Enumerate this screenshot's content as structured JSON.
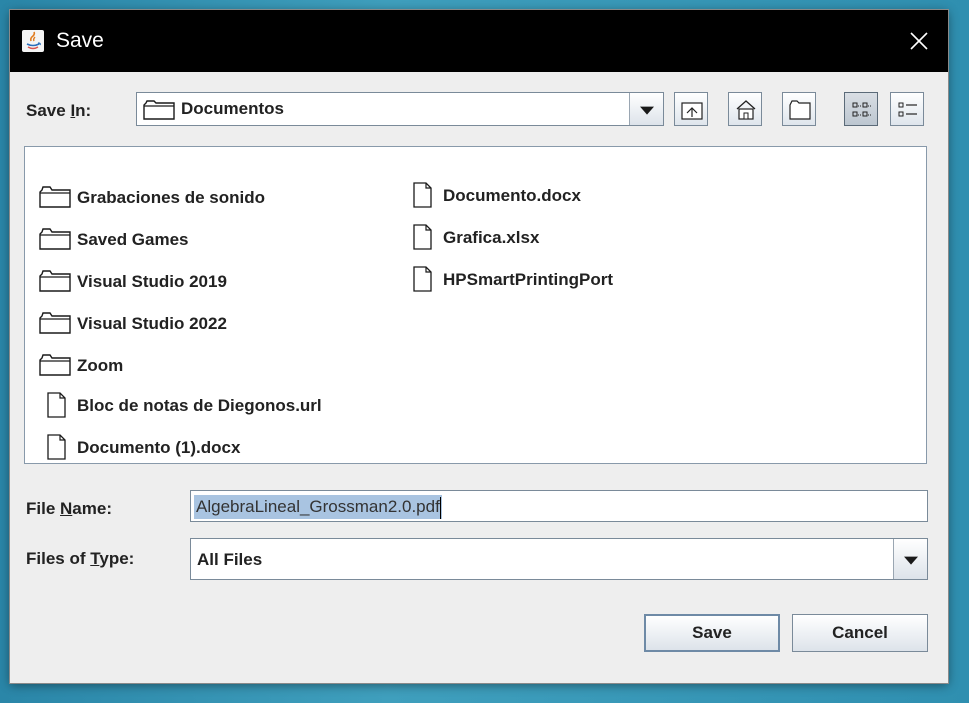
{
  "window": {
    "title": "Save"
  },
  "save_in": {
    "label_before": "Save ",
    "label_mnemonic": "I",
    "label_after": "n:",
    "value": "Documentos"
  },
  "files": {
    "column1": [
      {
        "name": "Grabaciones de sonido",
        "type": "folder"
      },
      {
        "name": "Saved Games",
        "type": "folder"
      },
      {
        "name": "Visual Studio 2019",
        "type": "folder"
      },
      {
        "name": "Visual Studio 2022",
        "type": "folder"
      },
      {
        "name": "Zoom",
        "type": "folder"
      },
      {
        "name": "Bloc de notas de Diegonos.url",
        "type": "file"
      },
      {
        "name": "Documento (1).docx",
        "type": "file"
      }
    ],
    "column2": [
      {
        "name": "Documento.docx",
        "type": "file"
      },
      {
        "name": "Grafica.xlsx",
        "type": "file"
      },
      {
        "name": "HPSmartPrintingPort",
        "type": "file"
      }
    ]
  },
  "file_name": {
    "label_before": "File ",
    "label_mnemonic": "N",
    "label_after": "ame:",
    "value": "AlgebraLineal_Grossman2.0.pdf"
  },
  "file_type": {
    "label_before": "Files of ",
    "label_mnemonic": "T",
    "label_after": "ype:",
    "value": "All Files"
  },
  "buttons": {
    "save": "Save",
    "cancel": "Cancel"
  },
  "colors": {
    "titlebar": "#000000",
    "selection": "#a9c4e1",
    "dialog_bg": "#eeeeee"
  }
}
